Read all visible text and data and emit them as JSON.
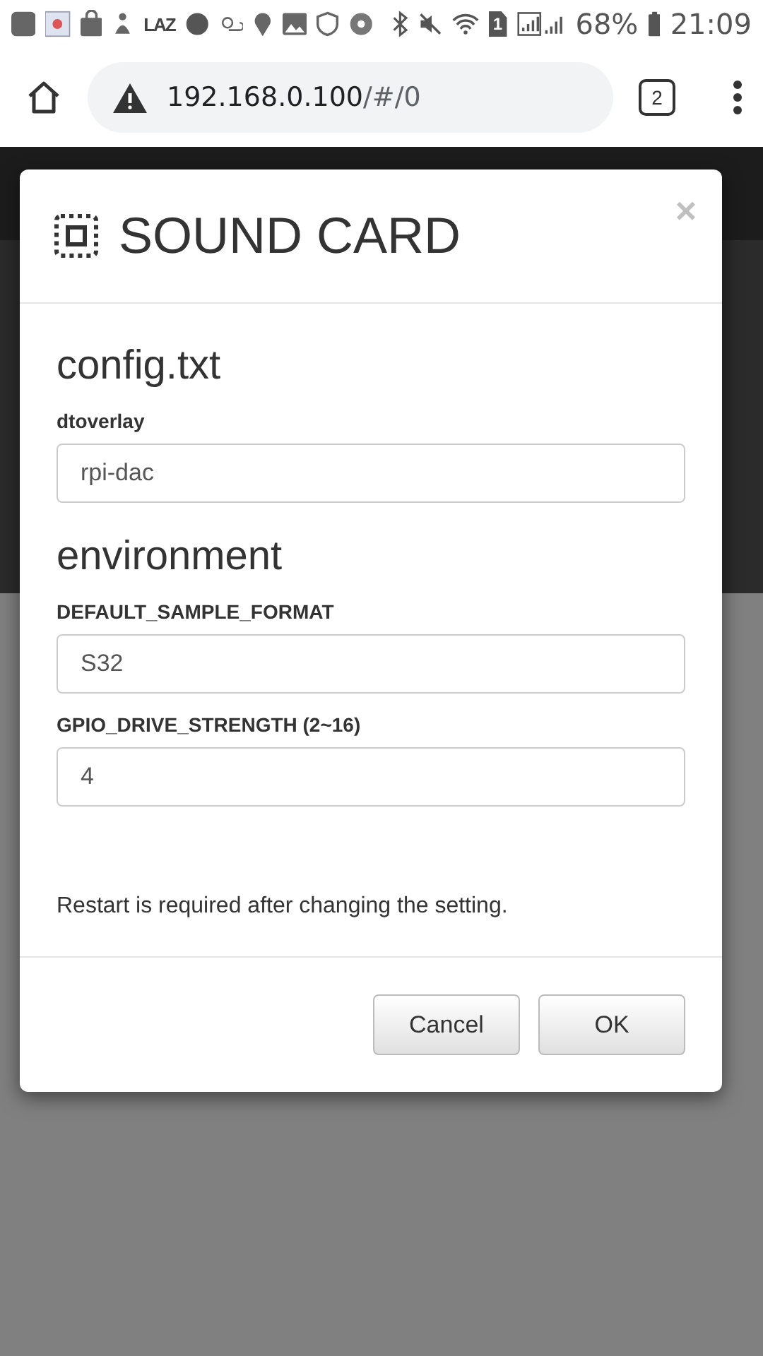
{
  "status_bar": {
    "app_label": "LAZ",
    "battery": "68%",
    "time": "21:09",
    "sim": "1"
  },
  "browser": {
    "url": "192.168.0.100/#/0",
    "tab_count": "2"
  },
  "dialog": {
    "title": "SOUND CARD",
    "close": "×",
    "sections": [
      {
        "heading": "config.txt",
        "fields": [
          {
            "label": "dtoverlay",
            "value": "rpi-dac"
          }
        ]
      },
      {
        "heading": "environment",
        "fields": [
          {
            "label": "DEFAULT_SAMPLE_FORMAT",
            "value": "S32"
          },
          {
            "label": "GPIO_DRIVE_STRENGTH (2~16)",
            "value": "4"
          }
        ]
      }
    ],
    "note": "Restart is required after changing the setting.",
    "buttons": [
      "Cancel",
      "OK"
    ]
  }
}
